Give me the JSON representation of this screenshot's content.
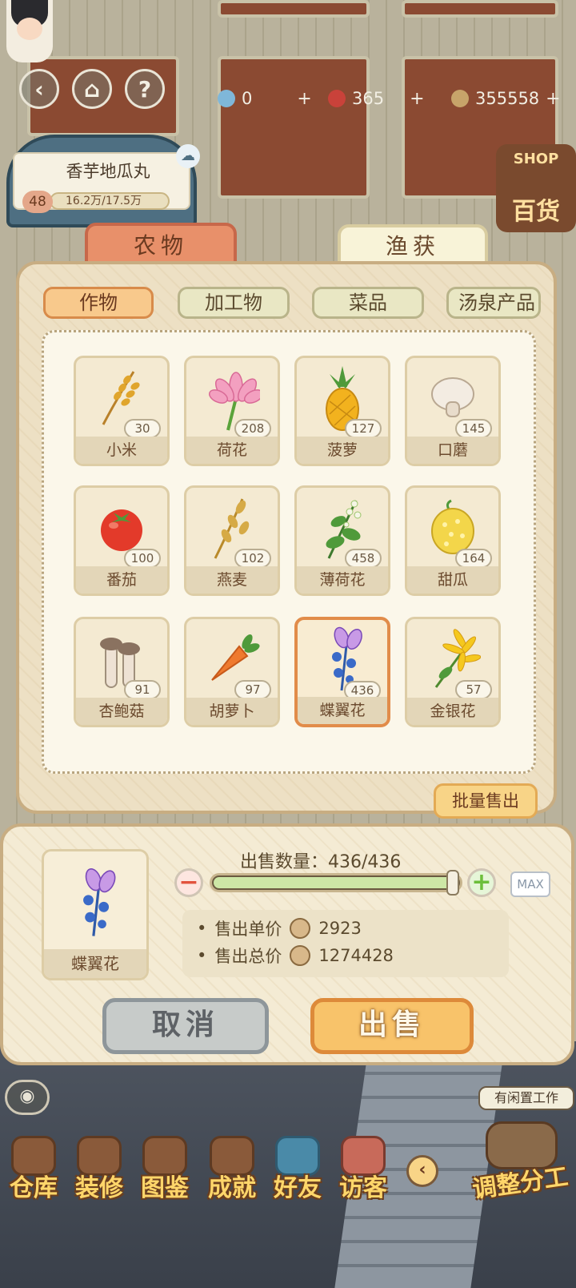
{
  "hud": {
    "resources": [
      {
        "icon": "water-drop-icon",
        "value": "0",
        "color": "#7fb7d9"
      },
      {
        "icon": "ruby-icon",
        "value": "365",
        "color": "#c9423a"
      },
      {
        "icon": "coin-icon",
        "value": "355558",
        "color": "#c7a46a"
      }
    ],
    "plus": "+",
    "field_name": "香芋地瓜丸",
    "level": "48",
    "progress_text": "16.2万/17.5万",
    "shop_label_en": "SHOP",
    "shop_label": "百货"
  },
  "panel": {
    "main_tabs": [
      "农物",
      "渔获"
    ],
    "sub_tabs": [
      "作物",
      "加工物",
      "菜品",
      "汤泉产品"
    ],
    "items": [
      {
        "name": "小米",
        "count": "30"
      },
      {
        "name": "荷花",
        "count": "208"
      },
      {
        "name": "菠萝",
        "count": "127"
      },
      {
        "name": "口蘑",
        "count": "145"
      },
      {
        "name": "番茄",
        "count": "100"
      },
      {
        "name": "燕麦",
        "count": "102"
      },
      {
        "name": "薄荷花",
        "count": "458"
      },
      {
        "name": "甜瓜",
        "count": "164"
      },
      {
        "name": "杏鲍菇",
        "count": "91"
      },
      {
        "name": "胡萝卜",
        "count": "97"
      },
      {
        "name": "蝶翼花",
        "count": "436",
        "selected": true
      },
      {
        "name": "金银花",
        "count": "57"
      }
    ],
    "batch_sell": "批量售出"
  },
  "sell": {
    "item_name": "蝶翼花",
    "qty_label": "出售数量：436/436",
    "qty_fraction": 1.0,
    "max_label": "MAX",
    "unit_price_label": "售出单价",
    "unit_price": "2923",
    "total_price_label": "售出总价",
    "total_price": "1274428",
    "cancel": "取消",
    "confirm": "出售"
  },
  "nav": {
    "items": [
      "仓库",
      "装修",
      "图鉴",
      "成就",
      "好友",
      "访客"
    ],
    "idle_tip": "有闲置工作",
    "assign": "调整分工"
  },
  "colors": {
    "accent": "#f8c36a",
    "panel": "#ede0c4",
    "selected_border": "#e18c4a"
  }
}
